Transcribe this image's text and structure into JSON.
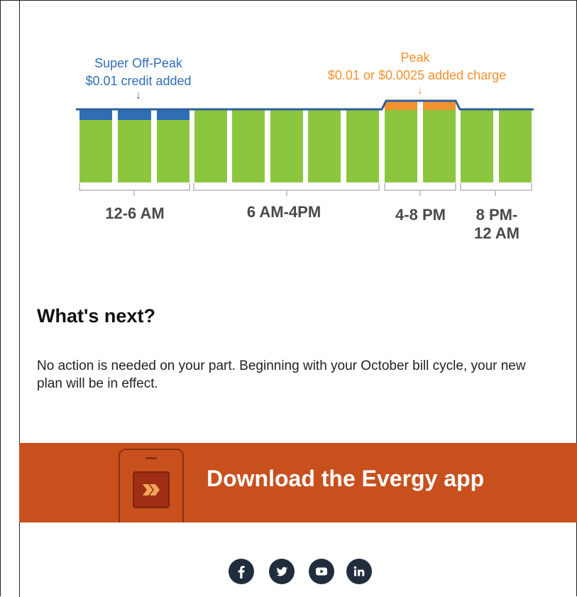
{
  "chart": {
    "super_off_peak_title": "Super Off-Peak",
    "super_off_peak_detail": "$0.01 credit added",
    "peak_title": "Peak",
    "peak_detail": "$0.01 or $0.0025 added charge",
    "arrow_glyph": "↓",
    "periods": [
      {
        "label": "12-6 AM"
      },
      {
        "label": "6 AM-4PM"
      },
      {
        "label": "4-8 PM"
      },
      {
        "label_line1": "8 PM-",
        "label_line2": "12 AM"
      }
    ],
    "colors": {
      "base": "#8cc63f",
      "credit": "#2f6eb5",
      "charge": "#f2922e",
      "line": "#2f5f9a",
      "bracket": "#c8c8c8"
    }
  },
  "next": {
    "heading": "What's next?",
    "body": "No action is needed on your part. Beginning with your October bill cycle, your new plan will be in effect."
  },
  "banner": {
    "text": "Download the Evergy app",
    "background": "#c7501d"
  },
  "social": [
    "facebook-icon",
    "twitter-icon",
    "youtube-icon",
    "linkedin-icon"
  ]
}
